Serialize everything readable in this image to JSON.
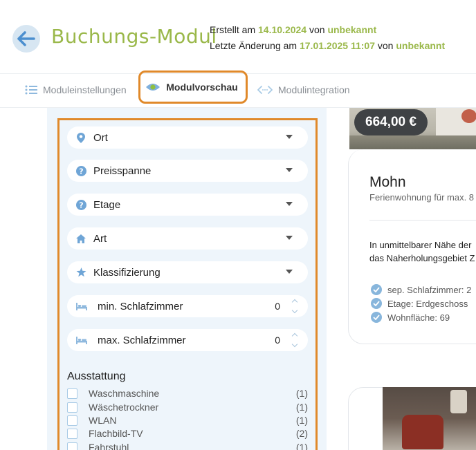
{
  "header": {
    "title": "Buchungs-Modul",
    "created_prefix": "Erstellt am",
    "created_date": "14.10.2024",
    "created_by_prefix": "von",
    "created_by": "unbekannt",
    "modified_prefix": "Letzte Änderung am",
    "modified_date": "17.01.2025 11:07",
    "modified_by_prefix": "von",
    "modified_by": "unbekannt"
  },
  "tabs": {
    "settings": "Moduleinstellungen",
    "preview": "Modulvorschau",
    "integration": "Modulintegration",
    "active": "preview"
  },
  "filters": {
    "location": "Ort",
    "price_range": "Preisspanne",
    "floor": "Etage",
    "type": "Art",
    "classification": "Klassifizierung",
    "min_bedrooms_label": "min. Schlafzimmer",
    "min_bedrooms_value": "0",
    "max_bedrooms_label": "max. Schlafzimmer",
    "max_bedrooms_value": "0"
  },
  "amenities": {
    "title": "Ausstattung",
    "items": [
      {
        "label": "Waschmaschine",
        "count": "(1)"
      },
      {
        "label": "Wäschetrockner",
        "count": "(1)"
      },
      {
        "label": "WLAN",
        "count": "(1)"
      },
      {
        "label": "Flachbild-TV",
        "count": "(2)"
      },
      {
        "label": "Fahrstuhl",
        "count": "(1)"
      }
    ]
  },
  "listing": {
    "price": "664,00 €",
    "name": "Mohn",
    "subtitle": "Ferienwohnung für max. 8",
    "description_line1": "In unmittelbarer Nähe der",
    "description_line2": "das Naherholungsgebiet Z",
    "features": [
      "sep. Schlafzimmer: 2",
      "Etage: Erdgeschoss",
      "Wohnfläche: 69"
    ]
  },
  "colors": {
    "accent_green": "#9ab84a",
    "highlight_orange": "#e0892a",
    "panel_bg": "#eef5fb",
    "icon_blue": "#6fa5d6"
  }
}
